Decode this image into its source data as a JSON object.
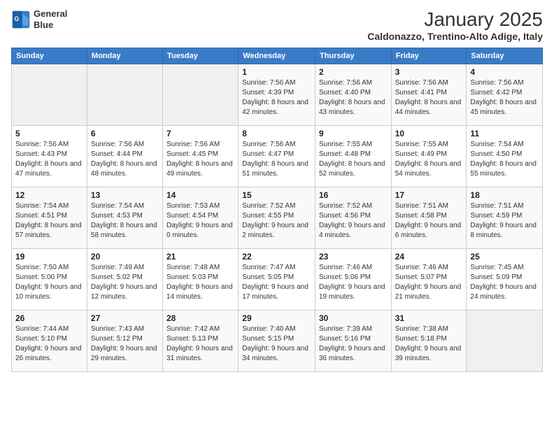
{
  "logo": {
    "line1": "General",
    "line2": "Blue"
  },
  "title": "January 2025",
  "subtitle": "Caldonazzo, Trentino-Alto Adige, Italy",
  "days_header": [
    "Sunday",
    "Monday",
    "Tuesday",
    "Wednesday",
    "Thursday",
    "Friday",
    "Saturday"
  ],
  "weeks": [
    [
      {
        "num": "",
        "info": ""
      },
      {
        "num": "",
        "info": ""
      },
      {
        "num": "",
        "info": ""
      },
      {
        "num": "1",
        "info": "Sunrise: 7:56 AM\nSunset: 4:39 PM\nDaylight: 8 hours and 42 minutes."
      },
      {
        "num": "2",
        "info": "Sunrise: 7:56 AM\nSunset: 4:40 PM\nDaylight: 8 hours and 43 minutes."
      },
      {
        "num": "3",
        "info": "Sunrise: 7:56 AM\nSunset: 4:41 PM\nDaylight: 8 hours and 44 minutes."
      },
      {
        "num": "4",
        "info": "Sunrise: 7:56 AM\nSunset: 4:42 PM\nDaylight: 8 hours and 45 minutes."
      }
    ],
    [
      {
        "num": "5",
        "info": "Sunrise: 7:56 AM\nSunset: 4:43 PM\nDaylight: 8 hours and 47 minutes."
      },
      {
        "num": "6",
        "info": "Sunrise: 7:56 AM\nSunset: 4:44 PM\nDaylight: 8 hours and 48 minutes."
      },
      {
        "num": "7",
        "info": "Sunrise: 7:56 AM\nSunset: 4:45 PM\nDaylight: 8 hours and 49 minutes."
      },
      {
        "num": "8",
        "info": "Sunrise: 7:56 AM\nSunset: 4:47 PM\nDaylight: 8 hours and 51 minutes."
      },
      {
        "num": "9",
        "info": "Sunrise: 7:55 AM\nSunset: 4:48 PM\nDaylight: 8 hours and 52 minutes."
      },
      {
        "num": "10",
        "info": "Sunrise: 7:55 AM\nSunset: 4:49 PM\nDaylight: 8 hours and 54 minutes."
      },
      {
        "num": "11",
        "info": "Sunrise: 7:54 AM\nSunset: 4:50 PM\nDaylight: 8 hours and 55 minutes."
      }
    ],
    [
      {
        "num": "12",
        "info": "Sunrise: 7:54 AM\nSunset: 4:51 PM\nDaylight: 8 hours and 57 minutes."
      },
      {
        "num": "13",
        "info": "Sunrise: 7:54 AM\nSunset: 4:53 PM\nDaylight: 8 hours and 58 minutes."
      },
      {
        "num": "14",
        "info": "Sunrise: 7:53 AM\nSunset: 4:54 PM\nDaylight: 9 hours and 0 minutes."
      },
      {
        "num": "15",
        "info": "Sunrise: 7:52 AM\nSunset: 4:55 PM\nDaylight: 9 hours and 2 minutes."
      },
      {
        "num": "16",
        "info": "Sunrise: 7:52 AM\nSunset: 4:56 PM\nDaylight: 9 hours and 4 minutes."
      },
      {
        "num": "17",
        "info": "Sunrise: 7:51 AM\nSunset: 4:58 PM\nDaylight: 9 hours and 6 minutes."
      },
      {
        "num": "18",
        "info": "Sunrise: 7:51 AM\nSunset: 4:59 PM\nDaylight: 9 hours and 8 minutes."
      }
    ],
    [
      {
        "num": "19",
        "info": "Sunrise: 7:50 AM\nSunset: 5:00 PM\nDaylight: 9 hours and 10 minutes."
      },
      {
        "num": "20",
        "info": "Sunrise: 7:49 AM\nSunset: 5:02 PM\nDaylight: 9 hours and 12 minutes."
      },
      {
        "num": "21",
        "info": "Sunrise: 7:48 AM\nSunset: 5:03 PM\nDaylight: 9 hours and 14 minutes."
      },
      {
        "num": "22",
        "info": "Sunrise: 7:47 AM\nSunset: 5:05 PM\nDaylight: 9 hours and 17 minutes."
      },
      {
        "num": "23",
        "info": "Sunrise: 7:46 AM\nSunset: 5:06 PM\nDaylight: 9 hours and 19 minutes."
      },
      {
        "num": "24",
        "info": "Sunrise: 7:46 AM\nSunset: 5:07 PM\nDaylight: 9 hours and 21 minutes."
      },
      {
        "num": "25",
        "info": "Sunrise: 7:45 AM\nSunset: 5:09 PM\nDaylight: 9 hours and 24 minutes."
      }
    ],
    [
      {
        "num": "26",
        "info": "Sunrise: 7:44 AM\nSunset: 5:10 PM\nDaylight: 9 hours and 26 minutes."
      },
      {
        "num": "27",
        "info": "Sunrise: 7:43 AM\nSunset: 5:12 PM\nDaylight: 9 hours and 29 minutes."
      },
      {
        "num": "28",
        "info": "Sunrise: 7:42 AM\nSunset: 5:13 PM\nDaylight: 9 hours and 31 minutes."
      },
      {
        "num": "29",
        "info": "Sunrise: 7:40 AM\nSunset: 5:15 PM\nDaylight: 9 hours and 34 minutes."
      },
      {
        "num": "30",
        "info": "Sunrise: 7:39 AM\nSunset: 5:16 PM\nDaylight: 9 hours and 36 minutes."
      },
      {
        "num": "31",
        "info": "Sunrise: 7:38 AM\nSunset: 5:18 PM\nDaylight: 9 hours and 39 minutes."
      },
      {
        "num": "",
        "info": ""
      }
    ]
  ]
}
